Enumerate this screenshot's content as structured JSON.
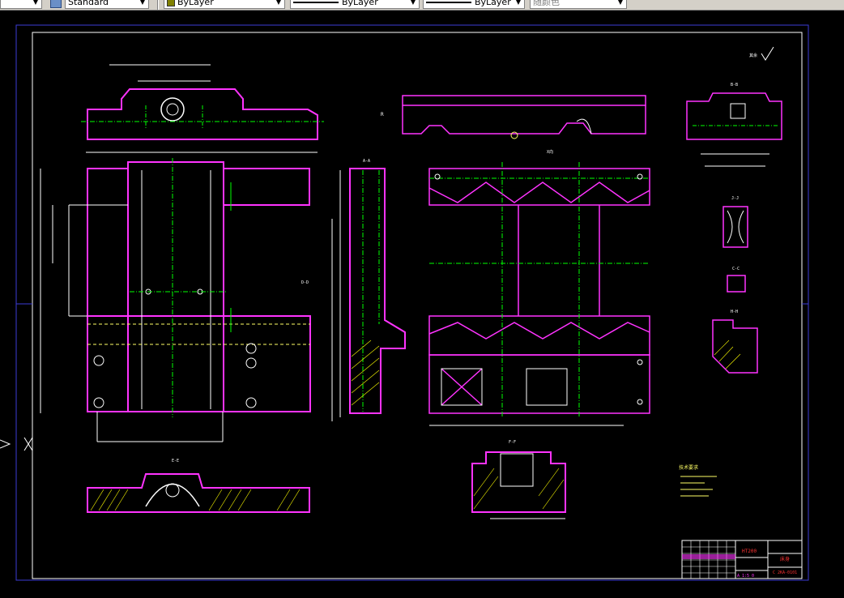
{
  "toolbar": {
    "text_style": "Standard",
    "color": "ByLayer",
    "color_swatch": "#808000",
    "linetype": "ByLayer",
    "lineweight": "ByLayer",
    "plot_style": "随颜色"
  },
  "drawing": {
    "section_labels": {
      "e_e": "E-E",
      "f_f": "F-F",
      "a_a": "A-A",
      "b_b": "B-B",
      "c_c": "C-C",
      "d_d": "D-D",
      "h_h": "H-H",
      "j_j": "J-J",
      "x_view": "X向",
      "r_view": "R"
    },
    "tech_notes_title": "技术要求",
    "surface_note": "其余",
    "title_block": {
      "material": "HT200",
      "part_name": "床身",
      "drawing_number": "C 2KA-0101",
      "scale_row": "A  1:5  0"
    },
    "colors": {
      "outline": "#ff33ff",
      "center": "#00ff00",
      "dimension": "#ffff66",
      "hatch": "#ffff00",
      "frame": "#3b3bd6",
      "white": "#ffffff",
      "red": "#ff3333"
    }
  }
}
